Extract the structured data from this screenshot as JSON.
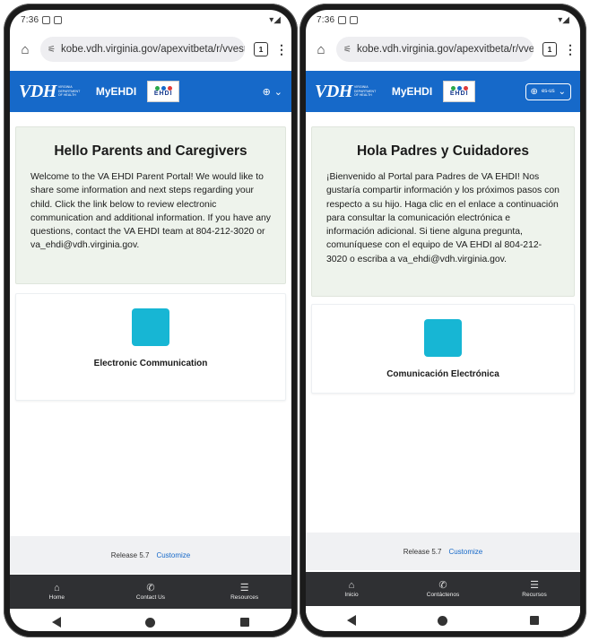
{
  "phones": [
    {
      "status": {
        "time": "7:36"
      },
      "browser": {
        "url": "kobe.vdh.virginia.gov/apexvitbeta/r/vvest",
        "tab_count": "1"
      },
      "header": {
        "logo_text": "VDH",
        "logo_subtext": "Virginia Department of Health",
        "app_title": "MyEHDI",
        "badge_text": "EHDI",
        "lang_code": ""
      },
      "welcome": {
        "title": "Hello Parents and Caregivers",
        "body": "Welcome to the VA EHDI Parent Portal! We would like to share some information and next steps regarding your child. Click the link below to review electronic communication and additional information. If you have any questions, contact the VA EHDI team at 804-212-3020 or va_ehdi@vdh.virginia.gov."
      },
      "tile": {
        "label": "Electronic Communication"
      },
      "footer": {
        "release": "Release 5.7",
        "customize": "Customize"
      },
      "nav": [
        {
          "label": "Home",
          "icon": "home-icon"
        },
        {
          "label": "Contact Us",
          "icon": "phone-icon"
        },
        {
          "label": "Resources",
          "icon": "list-icon"
        }
      ]
    },
    {
      "status": {
        "time": "7:36"
      },
      "browser": {
        "url": "kobe.vdh.virginia.gov/apexvitbeta/r/vvest",
        "tab_count": "1"
      },
      "header": {
        "logo_text": "VDH",
        "logo_subtext": "Virginia Department of Health",
        "app_title": "MyEHDI",
        "badge_text": "EHDI",
        "lang_code": "es-us"
      },
      "welcome": {
        "title": "Hola Padres y Cuidadores",
        "body": "¡Bienvenido al Portal para Padres de VA EHDI! Nos gustaría compartir información y los próximos pasos con respecto a su hijo. Haga clic en el enlace a continuación para consultar la comunicación electrónica e información adicional. Si tiene alguna pregunta, comuníquese con el equipo de VA EHDI al 804-212-3020 o escriba a va_ehdi@vdh.virginia.gov."
      },
      "tile": {
        "label": "Comunicación Electrónica"
      },
      "footer": {
        "release": "Release 5.7",
        "customize": "Customize"
      },
      "nav": [
        {
          "label": "Inicio",
          "icon": "home-icon"
        },
        {
          "label": "Contáctenos",
          "icon": "phone-icon"
        },
        {
          "label": "Recursos",
          "icon": "list-icon"
        }
      ]
    }
  ],
  "colors": {
    "brand_blue": "#1669c9",
    "tile_cyan": "#17b6d4",
    "hero_bg": "#eef3ec",
    "nav_dark": "#2f3033"
  }
}
